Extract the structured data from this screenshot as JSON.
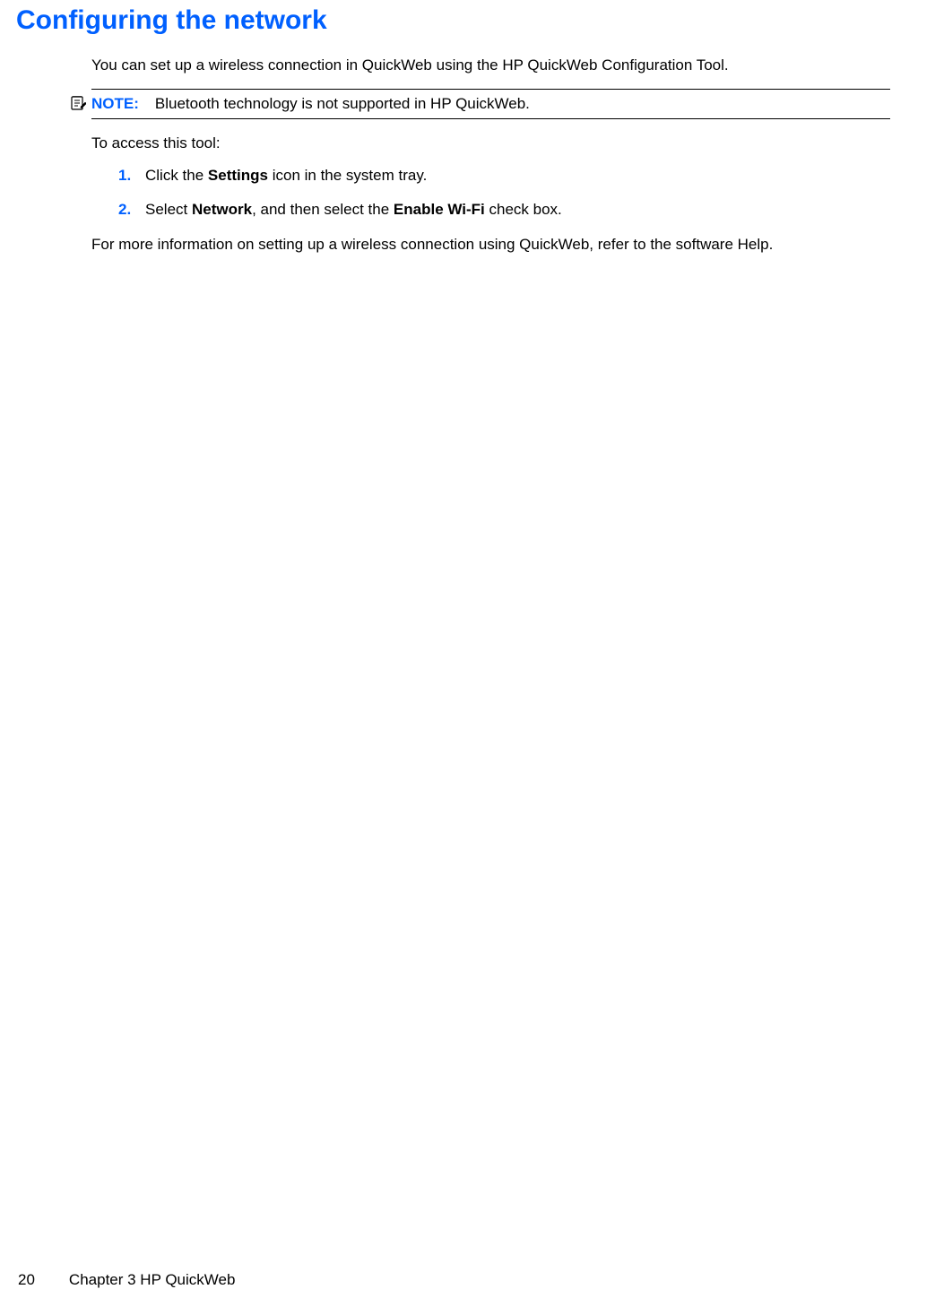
{
  "heading": "Configuring the network",
  "intro": "You can set up a wireless connection in QuickWeb using the HP QuickWeb Configuration Tool.",
  "note": {
    "label": "NOTE:",
    "text": "Bluetooth technology is not supported in HP QuickWeb."
  },
  "access_intro": "To access this tool:",
  "steps": [
    {
      "num": "1.",
      "pre": "Click the ",
      "bold1": "Settings",
      "post": " icon in the system tray."
    },
    {
      "num": "2.",
      "pre": "Select ",
      "bold1": "Network",
      "mid": ", and then select the ",
      "bold2": "Enable Wi-Fi",
      "post": " check box."
    }
  ],
  "outro": "For more information on setting up a wireless connection using QuickWeb, refer to the software Help.",
  "footer": {
    "page": "20",
    "chapter": "Chapter 3   HP QuickWeb"
  }
}
